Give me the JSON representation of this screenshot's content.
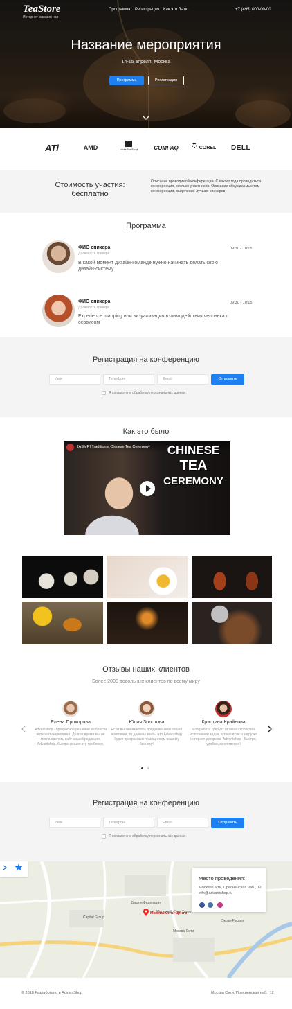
{
  "header": {
    "logo": "TeaStore",
    "logo_sub": "Интернет магазин чая",
    "nav": [
      "Программа",
      "Регистрация",
      "Как это было"
    ],
    "phone": "+7 (495) 000-00-00"
  },
  "hero": {
    "title": "Название мероприятия",
    "subtitle": "14-15 апреля, Москва",
    "btn_program": "Программа",
    "btn_register": "Регистрация"
  },
  "partners": [
    "ATi",
    "AMD",
    "Adobe PostScript",
    "COMPAQ",
    "COREL",
    "DELL"
  ],
  "price": {
    "title": "Стоимость участия: бесплатно",
    "description": "Описание проводимой конференции. С какого года проводиться конференция, сколько участников. Описание обсуждаемых тем конференции, выделение лучших спикеров"
  },
  "program": {
    "title": "Программа",
    "speakers": [
      {
        "name": "ФИО спикера",
        "position": "Должность спикера",
        "time": "09:30 - 10:15",
        "text": "В какой момент дизайн-команде нужно начинать делать свою дизайн-систему"
      },
      {
        "name": "ФИО спикера",
        "position": "Должность спикера",
        "time": "09:30 - 10:15",
        "text": "Experience mapping или визуализация взаимодействия человека с сервисом"
      }
    ]
  },
  "registration": {
    "title": "Регистрация на конференцию",
    "name_placeholder": "Имя",
    "phone_placeholder": "Телефон",
    "email_placeholder": "Email",
    "submit": "Отправить",
    "agree": "Я согласен на обработку персональных данных"
  },
  "history": {
    "title": "Как это было",
    "video_title": "[ASMR] Traditional Chinese Tea Ceremony",
    "video_overlay": [
      "CHINESE",
      "TEA",
      "CEREMONY"
    ]
  },
  "reviews": {
    "title": "Отзывы наших клиентов",
    "subtitle": "Более 2000 довольных клиентов по всему миру",
    "items": [
      {
        "name": "Елена Прохорова",
        "text": "Advantshop - прекрасное решение в области интернет-маркетинга. Долгое время мы не могли сделать сайт нашей редакции, Advantshop, быстро решил эту проблему."
      },
      {
        "name": "Юлия Золотова",
        "text": "Если вы занимаетесь продвижением вашей компании, то должны знать, что Advantshop будет прекрасным помощником вашему бизнесу!"
      },
      {
        "name": "Кристина Крайнова",
        "text": "Моя работа требует от меня скорости в исполнении задач, в том числе и загрузка интернет-ресурсов. Advantshop - быстро, удобно, качественно!"
      }
    ]
  },
  "map": {
    "place_title": "Место проведения:",
    "address": "Москва Сити, Пресненская наб., 12",
    "email": "info@advantshop.ru",
    "pin_label": "Москва-Сити Центр",
    "labels": [
      "Меркурий Сити Тауэр",
      "Башня Федерация",
      "Capital Group",
      "Москва-Сити",
      "Экспо-Россия"
    ]
  },
  "footer": {
    "copyright": "© 2018 Разработано в AdvantShop",
    "address": "Москва Сити, Пресненская наб., 12"
  },
  "colors": {
    "accent": "#1d7ff0",
    "light_bg": "#f4f4f4"
  }
}
